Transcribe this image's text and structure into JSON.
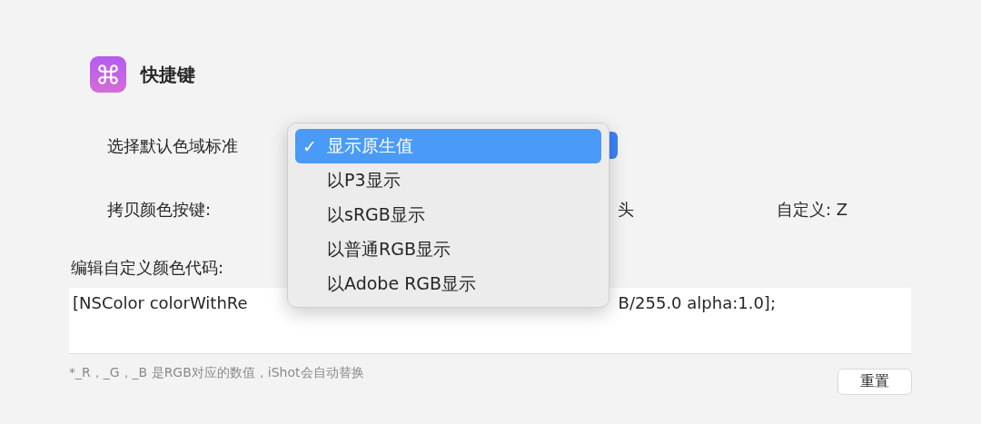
{
  "section": {
    "title": "快捷键"
  },
  "gamut": {
    "label": "选择默认色域标准"
  },
  "copy_key": {
    "label": "拷贝颜色按键:",
    "option_fragment": "头",
    "custom": "自定义: Z"
  },
  "custom_code": {
    "label": "编辑自定义颜色代码:",
    "value_left": "[NSColor colorWithRe",
    "value_right": "B/255.0 alpha:1.0];"
  },
  "hint": "*_R，_G，_B 是RGB对应的数值，iShot会自动替换",
  "reset_button": "重置",
  "menu": {
    "items": [
      {
        "label": "显示原生值",
        "check": "✓",
        "selected": true
      },
      {
        "label": "以P3显示",
        "selected": false
      },
      {
        "label": "以sRGB显示",
        "selected": false
      },
      {
        "label": "以普通RGB显示",
        "selected": false
      },
      {
        "label": "以Adobe RGB显示",
        "selected": false
      }
    ]
  }
}
